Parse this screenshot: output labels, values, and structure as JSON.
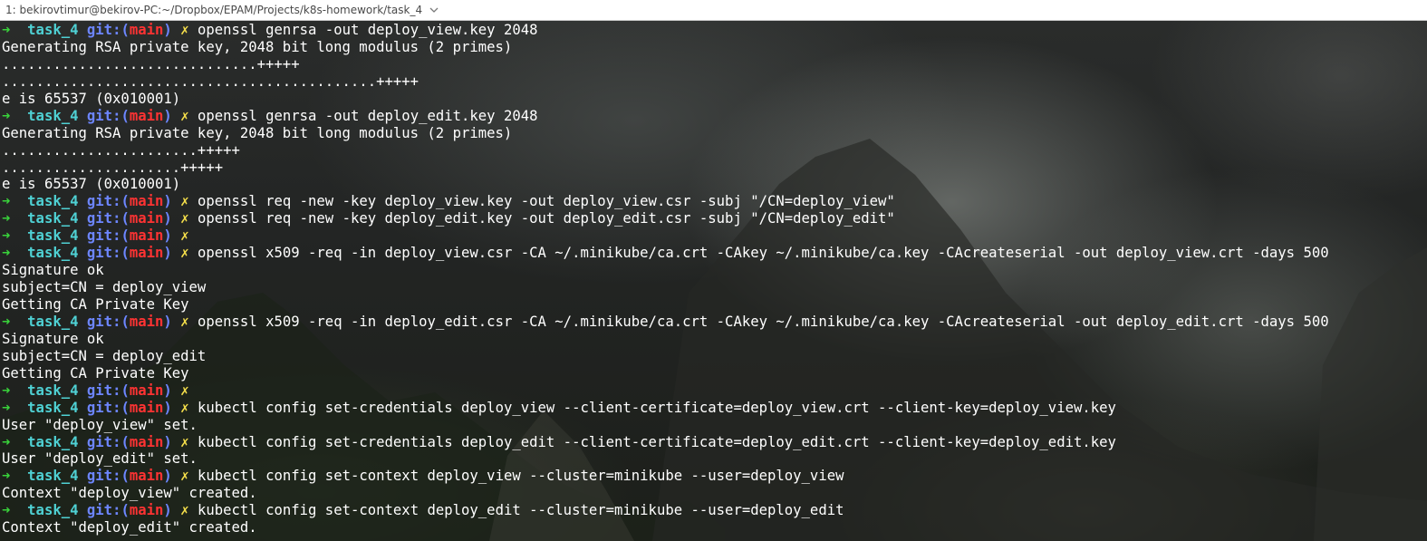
{
  "window": {
    "tab_title": "1: bekirovtimur@bekirov-PC:~/Dropbox/EPAM/Projects/k8s-homework/task_4"
  },
  "prompt": {
    "arrow": "➜",
    "dir": "task_4",
    "git_label": "git:(",
    "branch": "main",
    "git_close": ")",
    "dirty_mark": "✗"
  },
  "colors": {
    "prompt_arrow": "#39d33b",
    "prompt_dir": "#4fd1d4",
    "git": "#6d86ff",
    "branch": "#ff3333",
    "dirty": "#f6e04b",
    "text": "#ffffff"
  },
  "terminal": {
    "lines": [
      {
        "type": "prompt",
        "cmd": "openssl genrsa -out deploy_view.key 2048"
      },
      {
        "type": "output",
        "text": "Generating RSA private key, 2048 bit long modulus (2 primes)"
      },
      {
        "type": "output",
        "text": "..............................+++++"
      },
      {
        "type": "output",
        "text": "............................................+++++"
      },
      {
        "type": "output",
        "text": "e is 65537 (0x010001)"
      },
      {
        "type": "prompt",
        "cmd": "openssl genrsa -out deploy_edit.key 2048"
      },
      {
        "type": "output",
        "text": "Generating RSA private key, 2048 bit long modulus (2 primes)"
      },
      {
        "type": "output",
        "text": ".......................+++++"
      },
      {
        "type": "output",
        "text": ".....................+++++"
      },
      {
        "type": "output",
        "text": "e is 65537 (0x010001)"
      },
      {
        "type": "prompt",
        "cmd": "openssl req -new -key deploy_view.key -out deploy_view.csr -subj \"/CN=deploy_view\""
      },
      {
        "type": "prompt",
        "cmd": "openssl req -new -key deploy_edit.key -out deploy_edit.csr -subj \"/CN=deploy_edit\""
      },
      {
        "type": "prompt",
        "cmd": ""
      },
      {
        "type": "prompt",
        "cmd": "openssl x509 -req -in deploy_view.csr -CA ~/.minikube/ca.crt -CAkey ~/.minikube/ca.key -CAcreateserial -out deploy_view.crt -days 500"
      },
      {
        "type": "output",
        "text": "Signature ok"
      },
      {
        "type": "output",
        "text": "subject=CN = deploy_view"
      },
      {
        "type": "output",
        "text": "Getting CA Private Key"
      },
      {
        "type": "prompt",
        "cmd": "openssl x509 -req -in deploy_edit.csr -CA ~/.minikube/ca.crt -CAkey ~/.minikube/ca.key -CAcreateserial -out deploy_edit.crt -days 500"
      },
      {
        "type": "output",
        "text": "Signature ok"
      },
      {
        "type": "output",
        "text": "subject=CN = deploy_edit"
      },
      {
        "type": "output",
        "text": "Getting CA Private Key"
      },
      {
        "type": "prompt",
        "cmd": ""
      },
      {
        "type": "prompt",
        "cmd": "kubectl config set-credentials deploy_view --client-certificate=deploy_view.crt --client-key=deploy_view.key"
      },
      {
        "type": "output",
        "text": "User \"deploy_view\" set."
      },
      {
        "type": "prompt",
        "cmd": "kubectl config set-credentials deploy_edit --client-certificate=deploy_edit.crt --client-key=deploy_edit.key"
      },
      {
        "type": "output",
        "text": "User \"deploy_edit\" set."
      },
      {
        "type": "prompt",
        "cmd": "kubectl config set-context deploy_view --cluster=minikube --user=deploy_view"
      },
      {
        "type": "output",
        "text": "Context \"deploy_view\" created."
      },
      {
        "type": "prompt",
        "cmd": "kubectl config set-context deploy_edit --cluster=minikube --user=deploy_edit"
      },
      {
        "type": "output",
        "text": "Context \"deploy_edit\" created."
      }
    ]
  }
}
